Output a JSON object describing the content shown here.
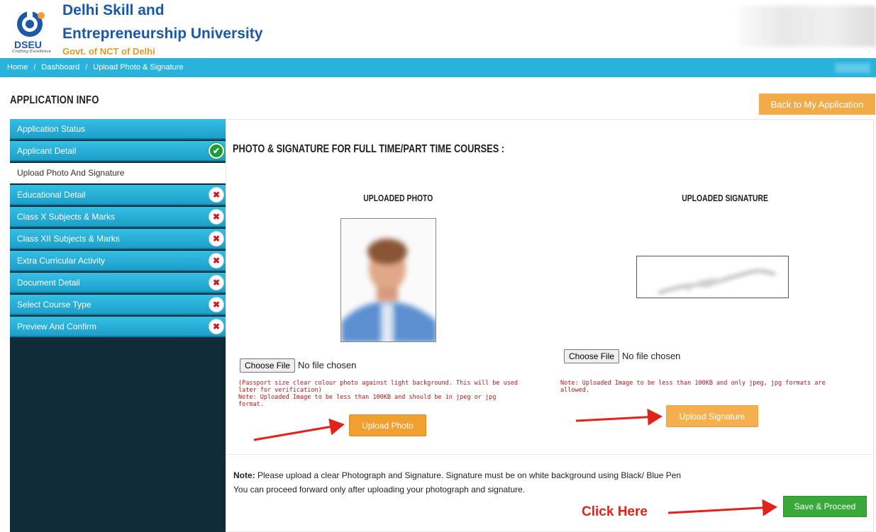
{
  "header": {
    "logo_text": "DSEU",
    "logo_tagline": "Crafting Excellence",
    "uni_line1": "Delhi Skill and",
    "uni_line2": "Entrepreneurship University",
    "govt": "Govt. of NCT of Delhi"
  },
  "breadcrumb": {
    "home": "Home",
    "sep": "/",
    "dashboard": "Dashboard",
    "current": "Upload Photo & Signature"
  },
  "page": {
    "title": "APPLICATION INFO",
    "back_button": "Back to My Application"
  },
  "sidebar": {
    "items": [
      {
        "label": "Application Status",
        "status": "none"
      },
      {
        "label": "Applicant Detail",
        "status": "done"
      },
      {
        "label": "Upload Photo And Signature",
        "status": "active"
      },
      {
        "label": "Educational Detail",
        "status": "pending"
      },
      {
        "label": "Class X Subjects & Marks",
        "status": "pending"
      },
      {
        "label": "Class XII Subjects & Marks",
        "status": "pending"
      },
      {
        "label": "Extra Curricular Activity",
        "status": "pending"
      },
      {
        "label": "Document Detail",
        "status": "pending"
      },
      {
        "label": "Select Course Type",
        "status": "pending"
      },
      {
        "label": "Preview And Confirm",
        "status": "pending"
      }
    ],
    "icons": {
      "done": "✔",
      "pending": "✖"
    }
  },
  "main": {
    "section_title": "PHOTO & SIGNATURE FOR FULL TIME/PART TIME COURSES :",
    "photo": {
      "title": "UPLOADED PHOTO",
      "choose_label": "Choose File",
      "file_status": "No file chosen",
      "note_lines": [
        "(Passport size clear colour photo against light background. This will be used",
        "later for verification)",
        "Note: Uploaded Image to be less than 100KB and should be in jpeg or jpg",
        "format."
      ],
      "upload_button": "Upload Photo"
    },
    "signature": {
      "title": "UPLOADED SIGNATURE",
      "choose_label": "Choose File",
      "file_status": "No file chosen",
      "note_lines": [
        "Note: Uploaded Image to be less than 100KB and only jpeg, jpg formats are",
        "allowed."
      ],
      "upload_button": "Upload Signature"
    },
    "bottom_note": {
      "label": "Note:",
      "line1": "Please upload a clear Photograph and Signature. Signature must be on white background using Black/ Blue Pen",
      "line2": "You can proceed forward only after uploading your photograph and signature."
    },
    "save_button": "Save & Proceed",
    "annotation": "Click Here"
  },
  "colors": {
    "brand_blue": "#1a58a8",
    "nav_cyan": "#29b2dc",
    "orange": "#f0a030",
    "green": "#3aa83a",
    "red": "#e2231a"
  }
}
